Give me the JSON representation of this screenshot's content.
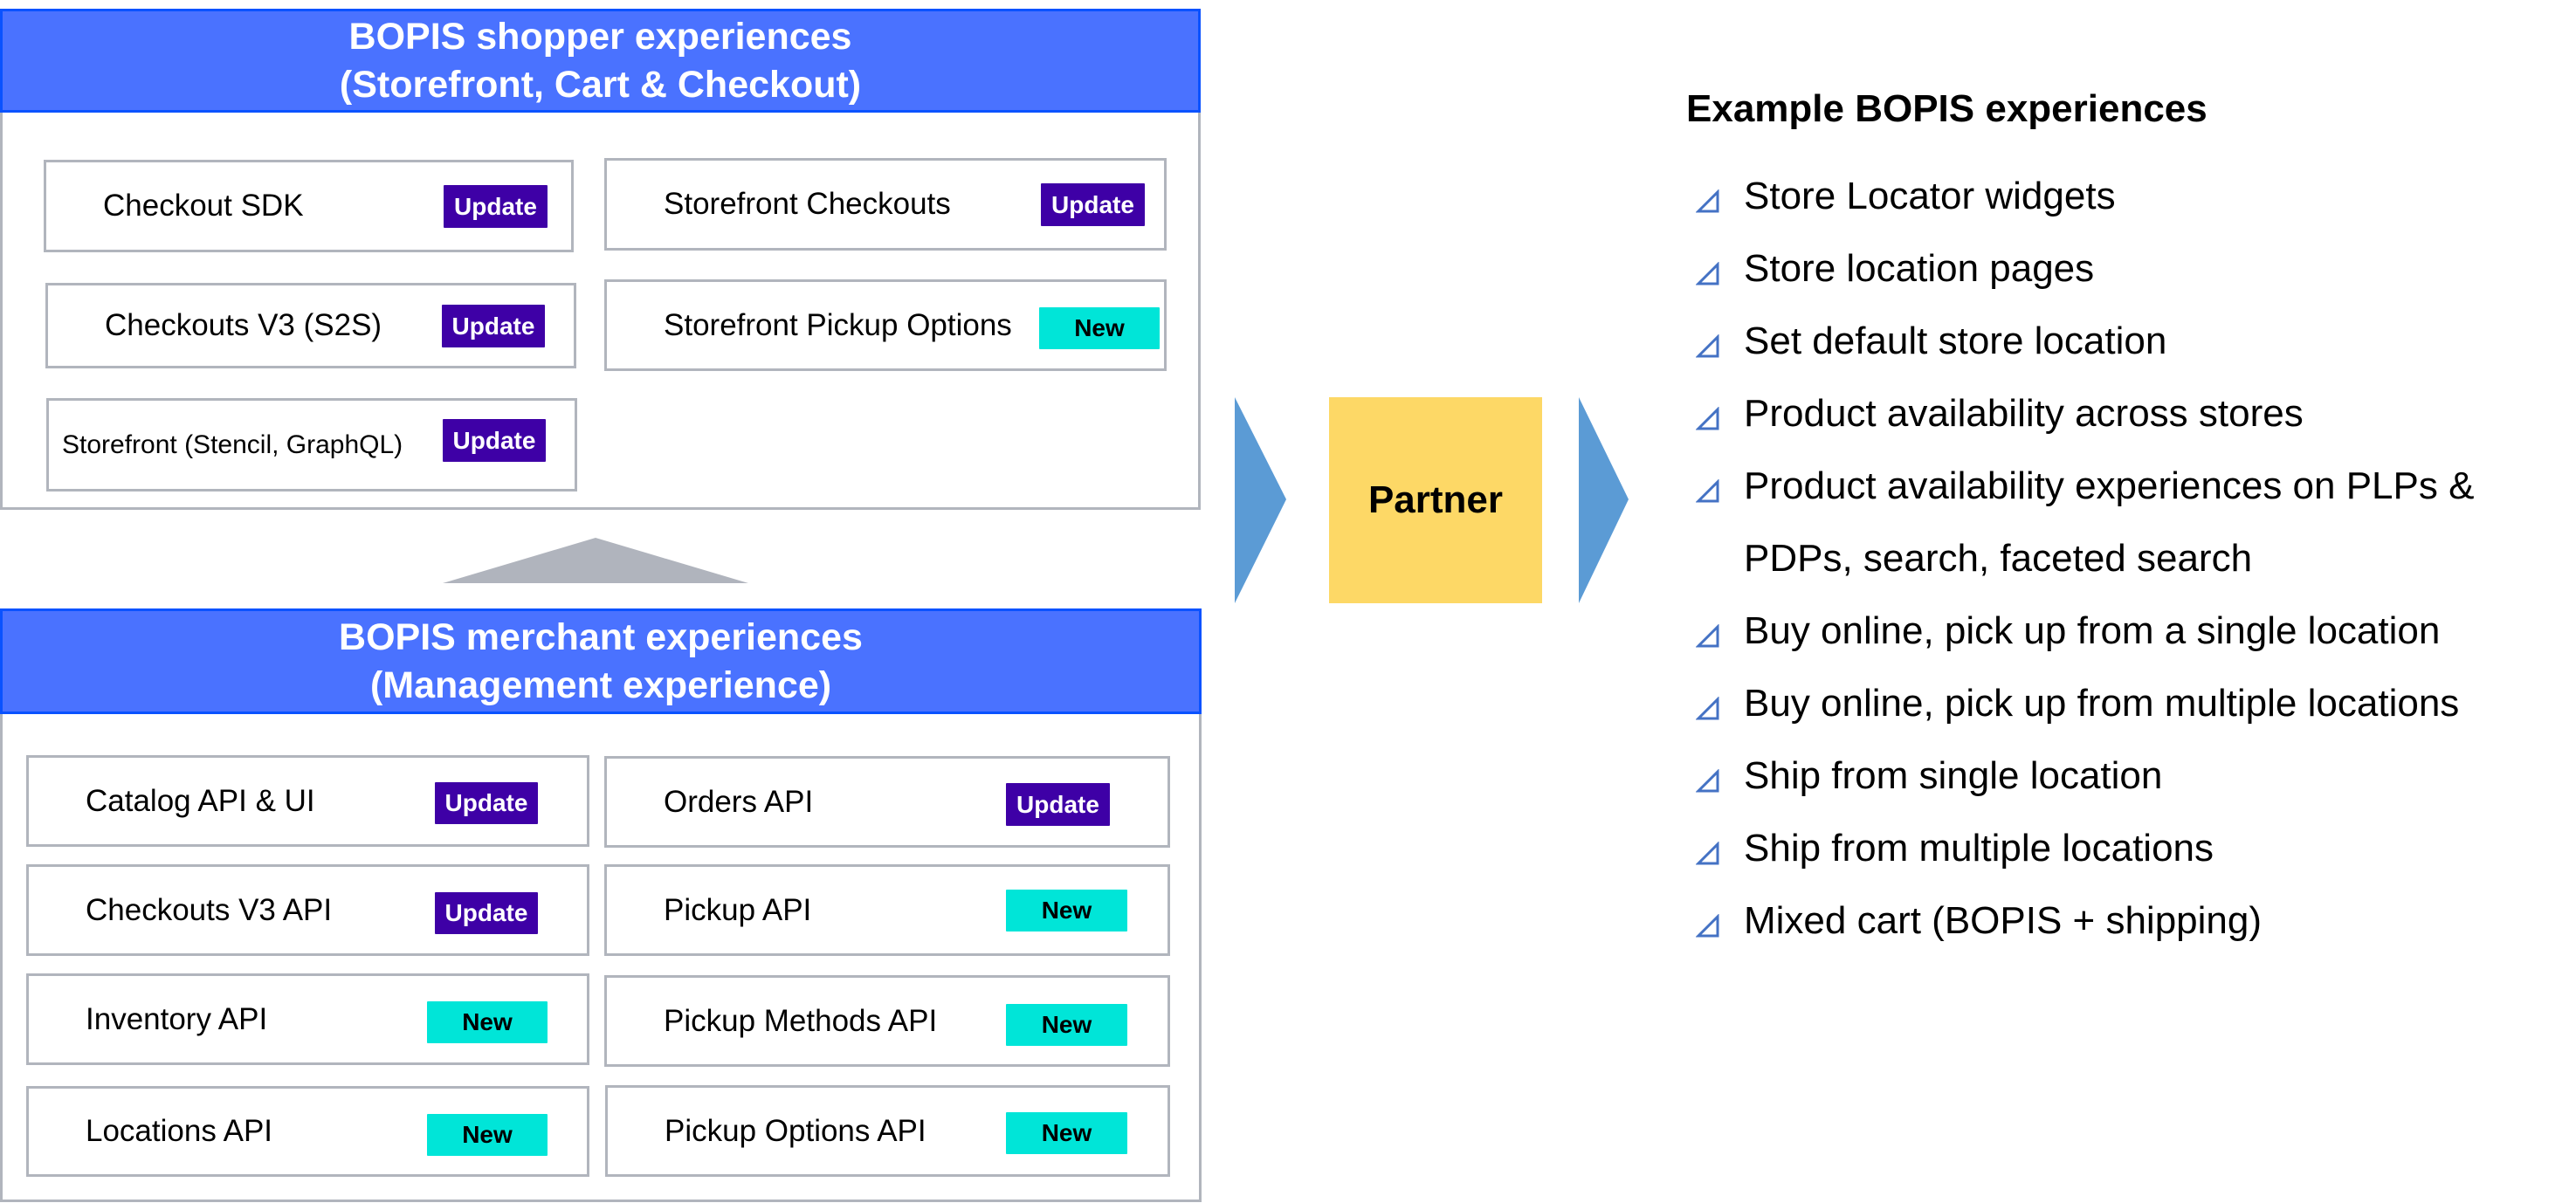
{
  "shopper_panel": {
    "title_line1": "BOPIS shopper experiences",
    "title_line2": "(Storefront, Cart & Checkout)",
    "cards": [
      {
        "label": "Checkout SDK",
        "badge": "Update"
      },
      {
        "label": "Storefront Checkouts",
        "badge": "Update"
      },
      {
        "label": "Checkouts V3 (S2S)",
        "badge": "Update"
      },
      {
        "label": "Storefront Pickup Options",
        "badge": "New"
      },
      {
        "label": "Storefront (Stencil, GraphQL)",
        "badge": "Update"
      }
    ]
  },
  "merchant_panel": {
    "title_line1": "BOPIS merchant experiences",
    "title_line2": "(Management experience)",
    "cards": [
      {
        "label": "Catalog API & UI",
        "badge": "Update"
      },
      {
        "label": "Orders API",
        "badge": "Update"
      },
      {
        "label": "Checkouts V3 API",
        "badge": "Update"
      },
      {
        "label": "Pickup API",
        "badge": "New"
      },
      {
        "label": "Inventory API",
        "badge": "New"
      },
      {
        "label": "Pickup Methods API",
        "badge": "New"
      },
      {
        "label": "Locations API",
        "badge": "New"
      },
      {
        "label": "Pickup Options API",
        "badge": "New"
      }
    ]
  },
  "flow": {
    "partner_label": "Partner",
    "arrow_icon": "chevron-right-icon",
    "connector_icon": "triangle-up-icon"
  },
  "examples": {
    "title": "Example BOPIS experiences",
    "bullet_icon": "right-triangle-bullet-icon",
    "items": [
      "Store Locator widgets",
      "Store location pages",
      "Set default store location",
      "Product availability across stores",
      "Product availability experiences on PLPs &",
      "PDPs, search, faceted search",
      "Buy online, pick up from a single location",
      "Buy online, pick up from multiple locations",
      "Ship from single location",
      "Ship from multiple locations",
      "Mixed cart (BOPIS + shipping)"
    ]
  },
  "colors": {
    "header_fill": "#4a72ff",
    "header_border": "#0a52ff",
    "update_badge": "#3e00a6",
    "new_badge": "#00e5d8",
    "partner_box": "#fdd866",
    "arrow": "#5b9bd5",
    "bullet": "#4472c4",
    "card_border": "#b1b5bd"
  }
}
